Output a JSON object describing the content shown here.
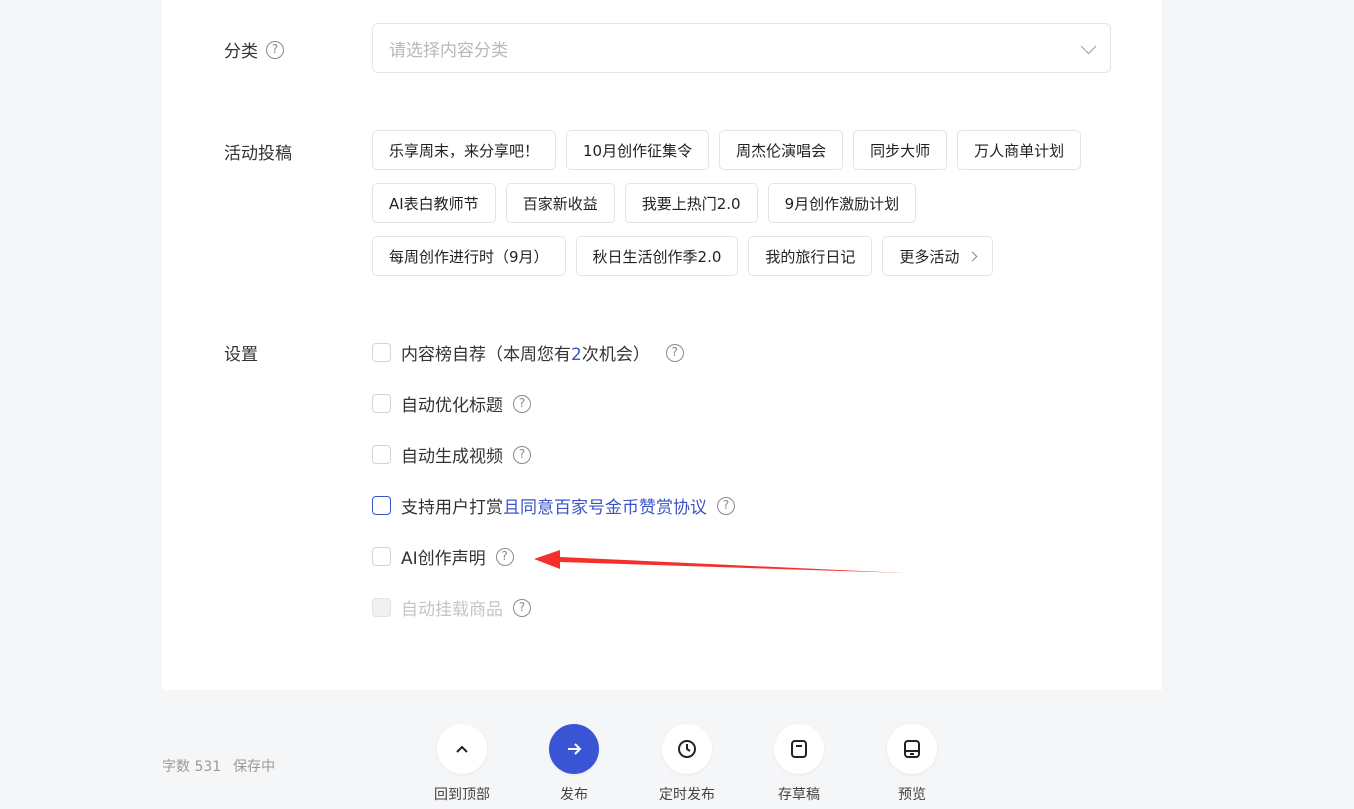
{
  "category": {
    "label": "分类",
    "placeholder": "请选择内容分类"
  },
  "activity": {
    "label": "活动投稿",
    "rows": [
      [
        "乐享周末，来分享吧！",
        "10月创作征集令",
        "周杰伦演唱会",
        "同步大师",
        "万人商单计划"
      ],
      [
        "AI表白教师节",
        "百家新收益",
        "我要上热门2.0",
        "9月创作激励计划"
      ],
      [
        "每周创作进行时（9月）",
        "秋日生活创作季2.0",
        "我的旅行日记",
        "更多活动"
      ]
    ]
  },
  "settings": {
    "label": "设置",
    "recommend_prefix": "内容榜自荐（本周您有",
    "recommend_count": "2",
    "recommend_suffix": "次机会）",
    "auto_title": "自动优化标题",
    "auto_video": "自动生成视频",
    "reward_prefix": "支持用户打赏",
    "reward_link": "且同意百家号金币赞赏协议",
    "ai_statement": "AI创作声明",
    "auto_goods": "自动挂载商品"
  },
  "footer": {
    "word_count": "字数 531",
    "save_status": "保存中",
    "actions": {
      "top": "回到顶部",
      "publish": "发布",
      "schedule": "定时发布",
      "draft": "存草稿",
      "preview": "预览"
    }
  },
  "colors": {
    "accent": "#3a54d6",
    "annotation_arrow": "#f5302a"
  }
}
